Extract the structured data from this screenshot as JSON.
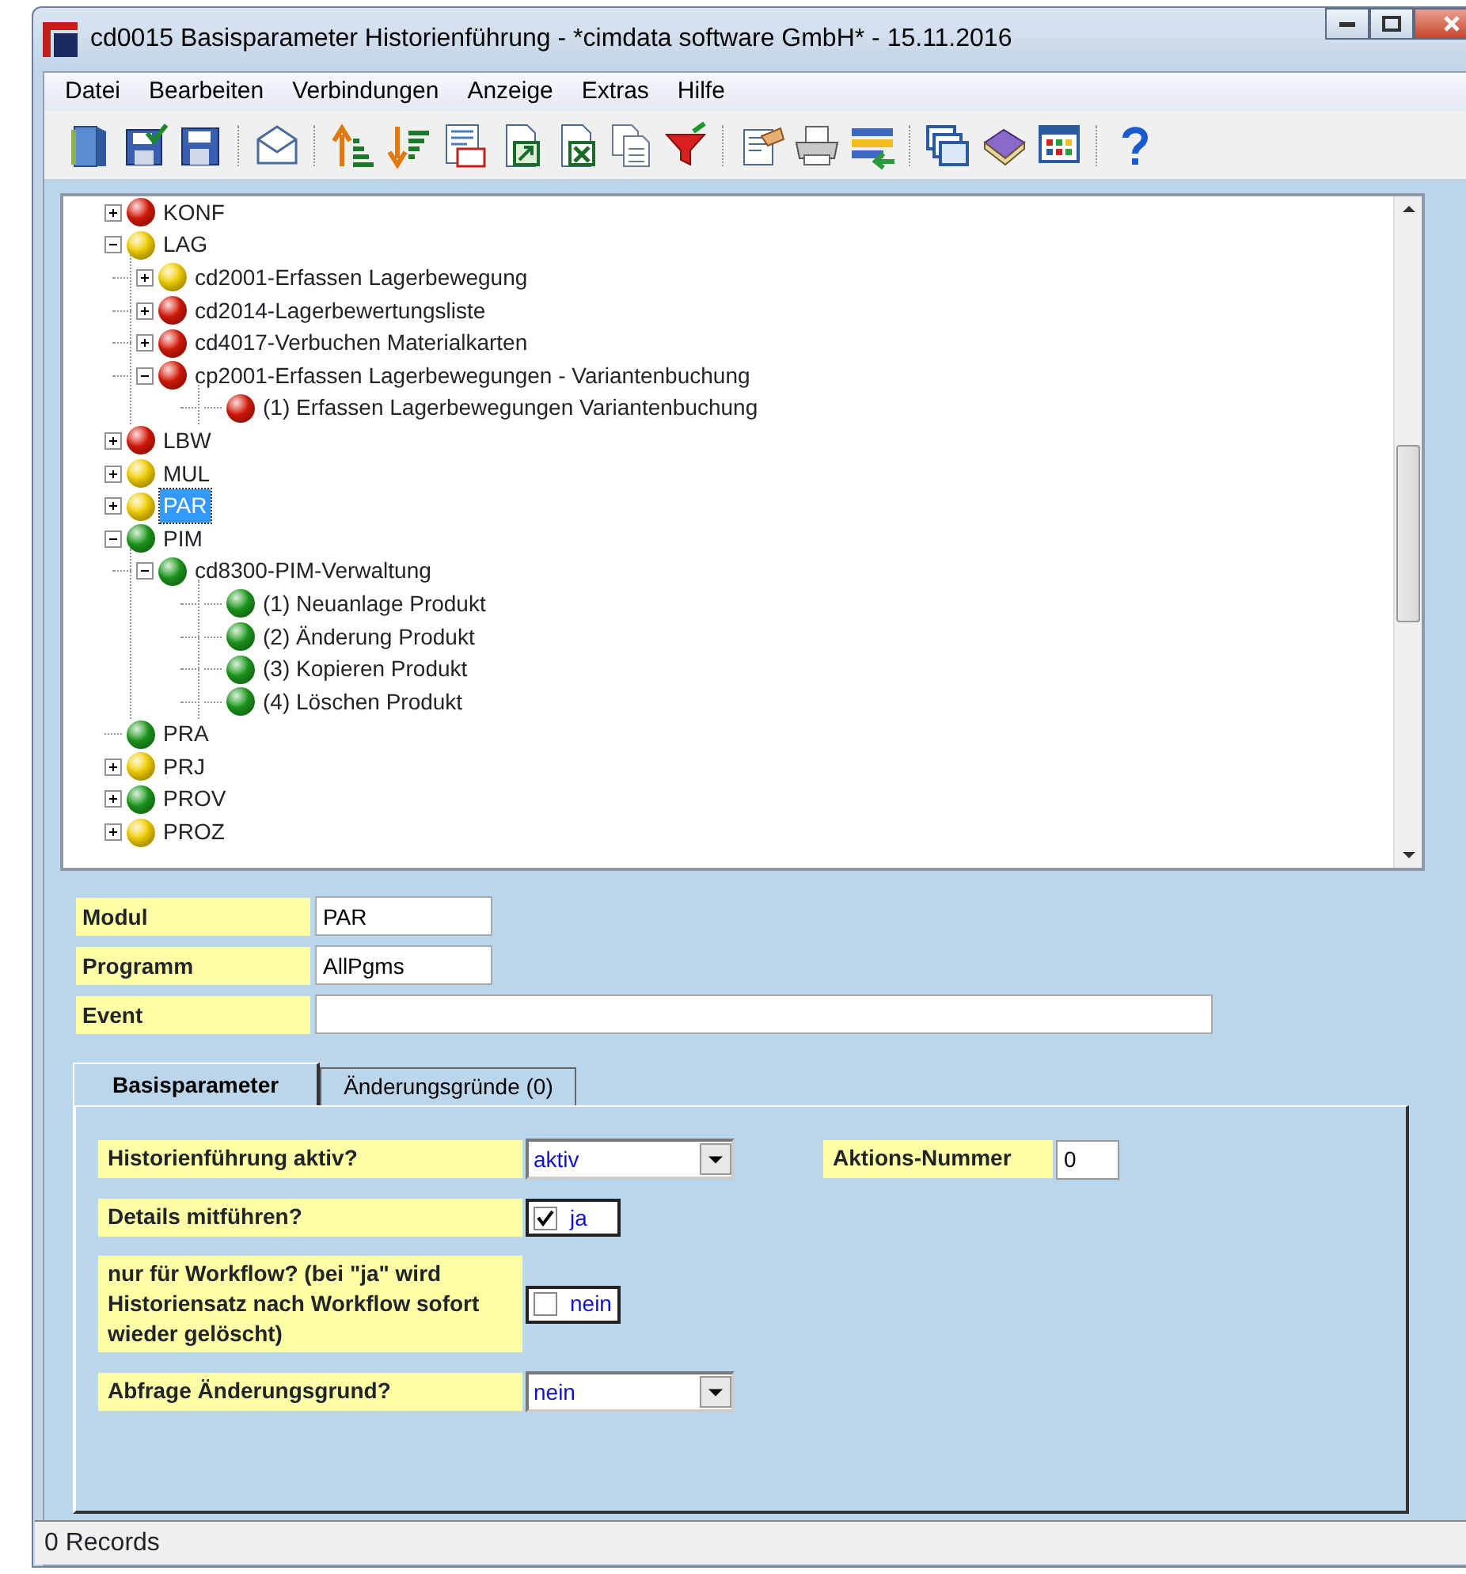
{
  "window": {
    "title": "cd0015 Basisparameter Historienführung - *cimdata software GmbH* - 15.11.2016"
  },
  "menu": [
    {
      "label": "Datei"
    },
    {
      "label": "Bearbeiten"
    },
    {
      "label": "Verbindungen"
    },
    {
      "label": "Anzeige"
    },
    {
      "label": "Extras"
    },
    {
      "label": "Hilfe"
    }
  ],
  "tree": [
    {
      "label": "KONF",
      "color": "#d81a0a",
      "expanded": false,
      "selected": false
    },
    {
      "label": "LAG",
      "color": "#f4d000",
      "expanded": true,
      "selected": false,
      "children": [
        {
          "label": "cd2001-Erfassen Lagerbewegung",
          "color": "#f4d000",
          "expanded": false,
          "selected": false
        },
        {
          "label": "cd2014-Lagerbewertungsliste",
          "color": "#d81a0a",
          "expanded": false,
          "selected": false
        },
        {
          "label": "cd4017-Verbuchen Materialkarten",
          "color": "#d81a0a",
          "expanded": false,
          "selected": false
        },
        {
          "label": "cp2001-Erfassen Lagerbewegungen - Variantenbuchung",
          "color": "#d81a0a",
          "expanded": true,
          "selected": false,
          "children": [
            {
              "label": "(1) Erfassen Lagerbewegungen Variantenbuchung",
              "color": "#d81a0a",
              "selected": false
            }
          ]
        }
      ]
    },
    {
      "label": "LBW",
      "color": "#d81a0a",
      "expanded": false,
      "selected": false
    },
    {
      "label": "MUL",
      "color": "#f4d000",
      "expanded": false,
      "selected": false
    },
    {
      "label": "PAR",
      "color": "#f4d000",
      "expanded": false,
      "selected": true
    },
    {
      "label": "PIM",
      "color": "#1d9a1d",
      "expanded": true,
      "selected": false,
      "children": [
        {
          "label": "cd8300-PIM-Verwaltung",
          "color": "#1d9a1d",
          "expanded": true,
          "selected": false,
          "children": [
            {
              "label": "(1) Neuanlage Produkt",
              "color": "#1d9a1d",
              "selected": false
            },
            {
              "label": "(2) Änderung Produkt",
              "color": "#1d9a1d",
              "selected": false
            },
            {
              "label": "(3) Kopieren Produkt",
              "color": "#1d9a1d",
              "selected": false
            },
            {
              "label": "(4) Löschen Produkt",
              "color": "#1d9a1d",
              "selected": false
            }
          ]
        }
      ]
    },
    {
      "label": "PRA",
      "color": "#1d9a1d",
      "selected": false
    },
    {
      "label": "PRJ",
      "color": "#f4d000",
      "expanded": false,
      "selected": false
    },
    {
      "label": "PROV",
      "color": "#1d9a1d",
      "expanded": false,
      "selected": false
    },
    {
      "label": "PROZ",
      "color": "#f4d000",
      "expanded": false,
      "selected": false
    }
  ],
  "fields": [
    {
      "label": "Modul",
      "value": "PAR"
    },
    {
      "label": "Programm",
      "value": "AllPgms"
    },
    {
      "label": "Event"
    }
  ],
  "tabs": [
    {
      "label": "Basisparameter",
      "selected": true
    },
    {
      "label": "Änderungsgründe (0)",
      "selected": false
    }
  ],
  "params": [
    {
      "kind": "dropdown",
      "label": "Historienführung aktiv?",
      "value": "aktiv"
    },
    {
      "kind": "checkbox",
      "label": "Details mitführen?",
      "checked": true,
      "value": "ja"
    },
    {
      "kind": "checkbox",
      "label": "nur für Workflow? (bei \"ja\" wird Historiensatz nach Workflow sofort wieder gelöscht)",
      "checked": false,
      "value": "nein"
    },
    {
      "kind": "dropdown",
      "label": "Abfrage Änderungsgrund?",
      "value": "nein"
    }
  ],
  "aktions_nummer": {
    "label": "Aktions-Nummer",
    "value": "0"
  },
  "status_bar": "0 Records"
}
